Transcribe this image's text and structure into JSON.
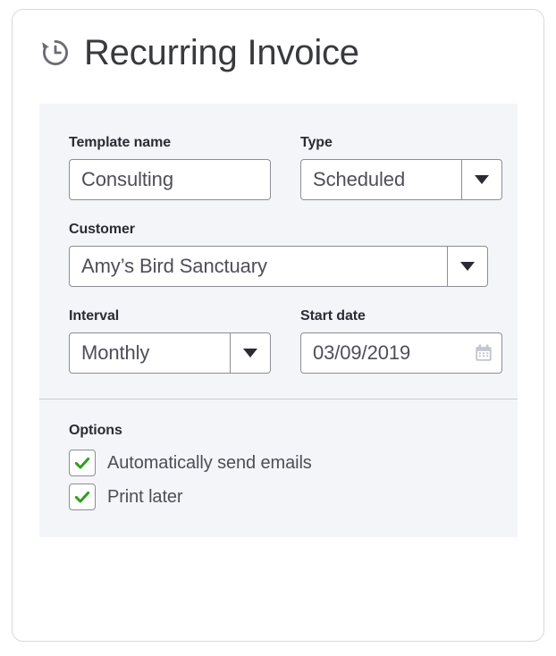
{
  "header": {
    "icon": "history-clock-icon",
    "title": "Recurring Invoice"
  },
  "form": {
    "template_name": {
      "label": "Template name",
      "value": "Consulting"
    },
    "type": {
      "label": "Type",
      "value": "Scheduled",
      "dropdown_icon": "chevron-down-icon"
    },
    "customer": {
      "label": "Customer",
      "value": "Amy’s Bird Sanctuary",
      "dropdown_icon": "chevron-down-icon"
    },
    "interval": {
      "label": "Interval",
      "value": "Monthly",
      "dropdown_icon": "chevron-down-icon"
    },
    "start_date": {
      "label": "Start date",
      "value": "03/09/2019",
      "calendar_icon": "calendar-icon"
    }
  },
  "options": {
    "title": "Options",
    "items": [
      {
        "label": "Automatically send emails",
        "checked": true
      },
      {
        "label": "Print later",
        "checked": true
      }
    ]
  },
  "colors": {
    "panel_bg": "#f4f5f8",
    "check_green": "#2ca01c",
    "border": "#8d8d95",
    "label_text": "#2b2b33",
    "value_text": "#4e4e56"
  }
}
